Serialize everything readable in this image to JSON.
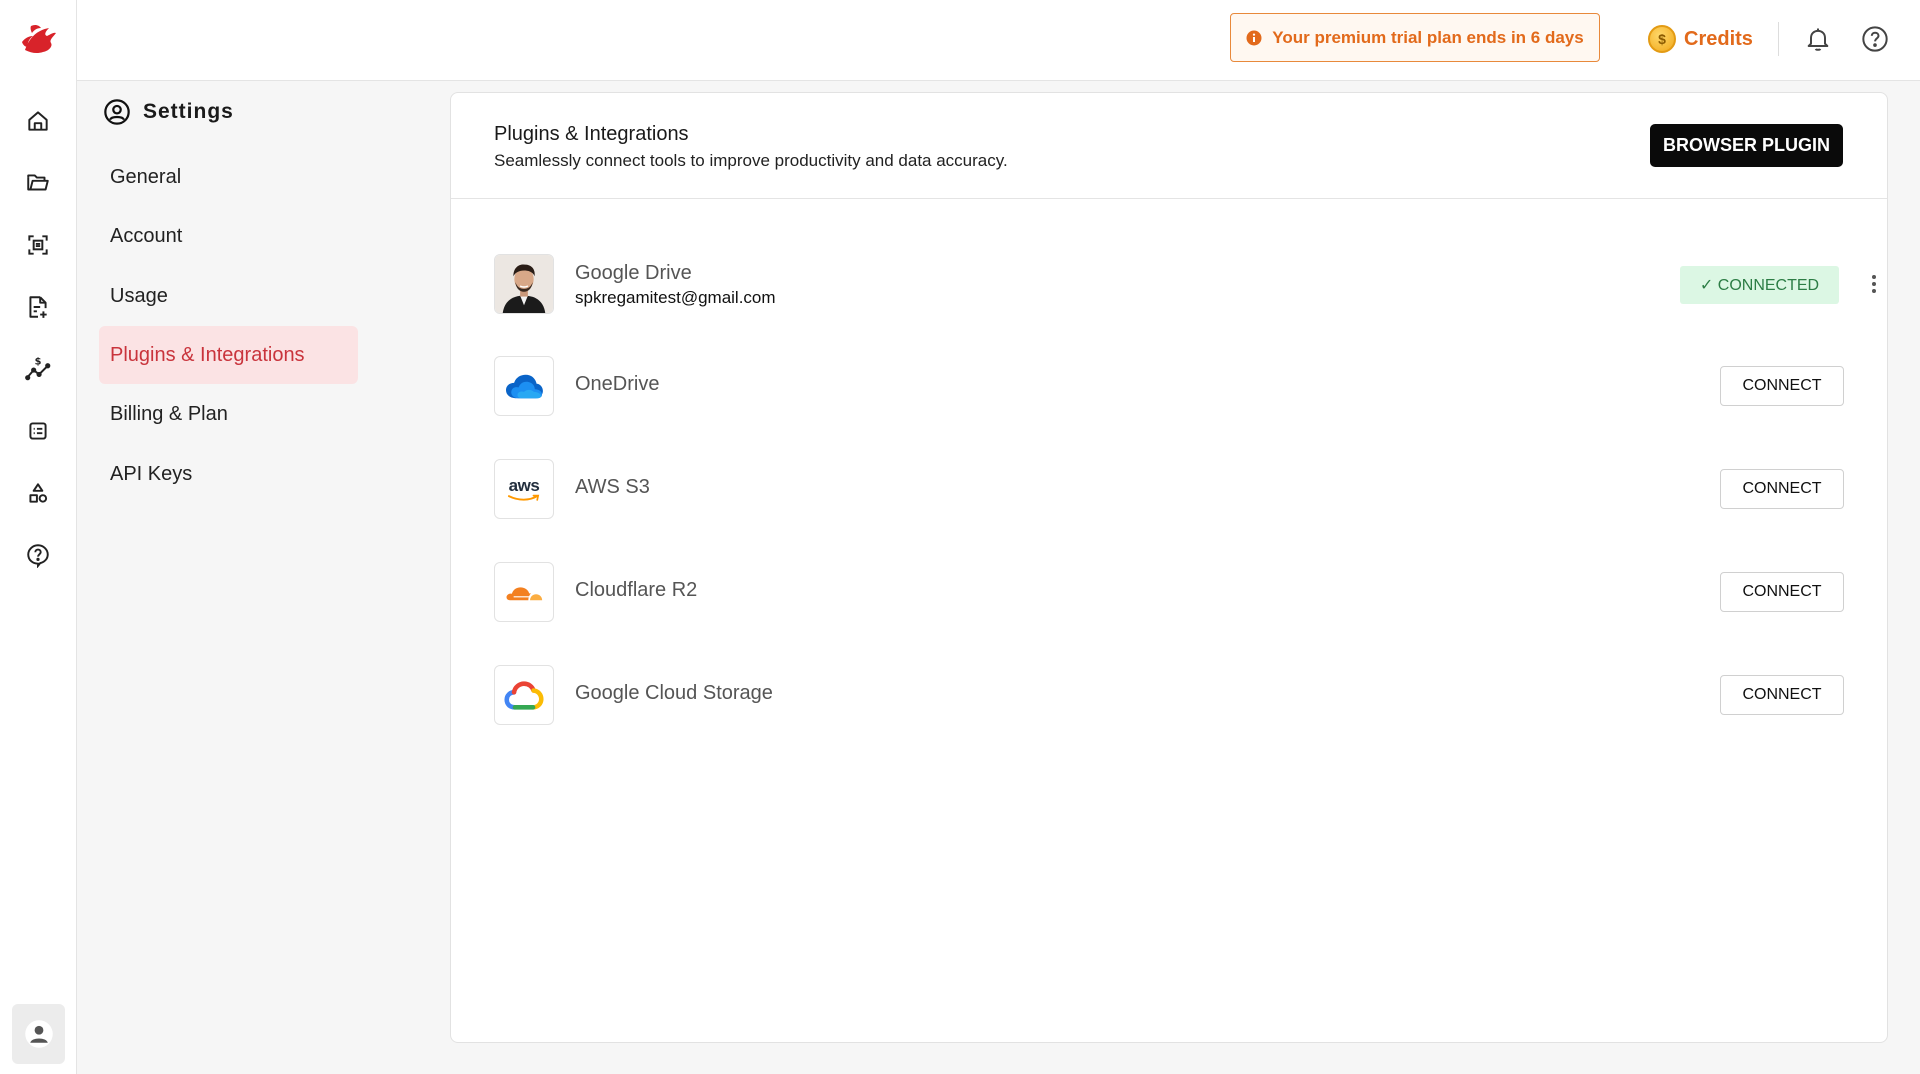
{
  "topbar": {
    "trial_text": "Your premium trial plan ends in 6 days",
    "credits_label": "Credits",
    "coin_symbol": "$"
  },
  "rail": {
    "icons": [
      "home-icon",
      "folder-icon",
      "scan-icon",
      "document-add-icon",
      "pricing-chart-icon",
      "checklist-icon",
      "shapes-icon",
      "help-icon"
    ]
  },
  "settings": {
    "title": "Settings",
    "nav": [
      {
        "label": "General",
        "active": false
      },
      {
        "label": "Account",
        "active": false
      },
      {
        "label": "Usage",
        "active": false
      },
      {
        "label": "Plugins & Integrations",
        "active": true
      },
      {
        "label": "Billing & Plan",
        "active": false
      },
      {
        "label": "API Keys",
        "active": false
      }
    ]
  },
  "main": {
    "title": "Plugins & Integrations",
    "subtitle": "Seamlessly connect tools to improve productivity and data accuracy.",
    "browser_plugin_label": "BROWSER PLUGIN",
    "integrations": [
      {
        "name": "Google Drive",
        "email": "spkregamitest@gmail.com",
        "status": "✓ CONNECTED"
      },
      {
        "name": "OneDrive",
        "action": "CONNECT"
      },
      {
        "name": "AWS S3",
        "action": "CONNECT",
        "logo_text": "aws"
      },
      {
        "name": "Cloudflare R2",
        "action": "CONNECT"
      },
      {
        "name": "Google Cloud Storage",
        "action": "CONNECT"
      }
    ]
  },
  "colors": {
    "accent": "#c9343c",
    "warning": "#e26a1b",
    "connected_bg": "#dcf7e4",
    "connected_text": "#2c7d45"
  }
}
